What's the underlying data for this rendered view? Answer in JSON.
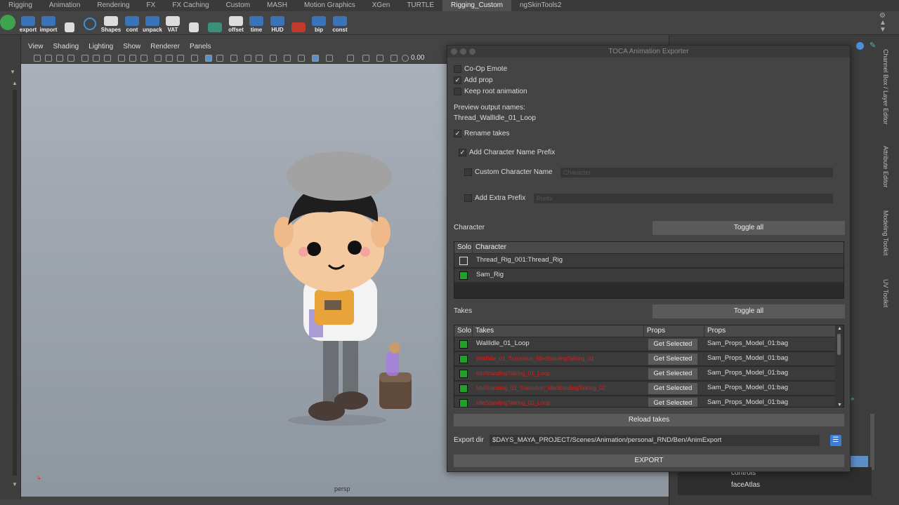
{
  "shelf": {
    "tabs": [
      "Rigging",
      "Animation",
      "Rendering",
      "FX",
      "FX Caching",
      "Custom",
      "MASH",
      "Motion Graphics",
      "XGen",
      "TURTLE",
      "Rigging_Custom",
      "ngSkinTools2"
    ],
    "active_tab": "Rigging_Custom",
    "buttons": [
      "export",
      "import",
      "Shapes",
      "cont",
      "unpack",
      "VAT",
      "offset",
      "time",
      "HUD",
      "bip",
      "const"
    ]
  },
  "viewport": {
    "menus": [
      "View",
      "Shading",
      "Lighting",
      "Show",
      "Renderer",
      "Panels"
    ],
    "time_field": "0.00",
    "camera_label": "persp"
  },
  "right_panel": {
    "side_tabs": [
      "Channel Box / Layer Editor",
      "Attribute Editor",
      "Modeling Toolkit",
      "UV Toolkit"
    ],
    "outliner_items": [
      "controls",
      "faceAtlas"
    ]
  },
  "dialog": {
    "title": "TOCA Animation Exporter",
    "options": [
      {
        "label": "Co-Op Emote",
        "checked": false
      },
      {
        "label": "Add prop",
        "checked": true
      },
      {
        "label": "Keep root animation",
        "checked": false
      }
    ],
    "preview_label": "Preview output names:",
    "preview_value": "Thread_WallIdle_01_Loop",
    "rename_takes": {
      "label": "Rename takes",
      "checked": true
    },
    "add_char_prefix": {
      "label": "Add Character Name Prefix",
      "checked": true
    },
    "custom_char_name": {
      "label": "Custom Character Name",
      "checked": false,
      "placeholder": "Character"
    },
    "extra_prefix": {
      "label": "Add Extra Prefix",
      "checked": false,
      "placeholder": "Prefix"
    },
    "character_section": {
      "label": "Character",
      "toggle_all": "Toggle all",
      "headers": [
        "Solo",
        "Character"
      ],
      "rows": [
        "Thread_Rig_001:Thread_Rig",
        "Sam_Rig"
      ]
    },
    "takes_section": {
      "label": "Takes",
      "toggle_all": "Toggle all",
      "headers": [
        "Solo",
        "Takes",
        "Props",
        "Props"
      ],
      "get_selected": "Get Selected",
      "rows": [
        {
          "take": "WallIdle_01_Loop",
          "prop": "Sam_Props_Model_01:bag",
          "error": false
        },
        {
          "take": "WallIdle_01_Transition_IdleStandingTalking_01",
          "prop": "Sam_Props_Model_01:bag",
          "error": true
        },
        {
          "take": "IdleStandingTalking_01_Loop",
          "prop": "Sam_Props_Model_01:bag",
          "error": true
        },
        {
          "take": "IdleStanding_01_Transition_IdleStandingTalking_02",
          "prop": "Sam_Props_Model_01:bag",
          "error": true
        },
        {
          "take": "IdleStandingTalking_02_Loop",
          "prop": "Sam_Props_Model_01:bag",
          "error": true
        }
      ]
    },
    "reload_takes": "Reload takes",
    "export_dir_label": "Export dir",
    "export_dir_value": "$DAYS_MAYA_PROJECT/Scenes/Animation/personal_RND/Ben/AnimExport",
    "export_button": "EXPORT"
  },
  "colors": {
    "solo_on": "#1fa12a",
    "error_text": "#d42020"
  }
}
